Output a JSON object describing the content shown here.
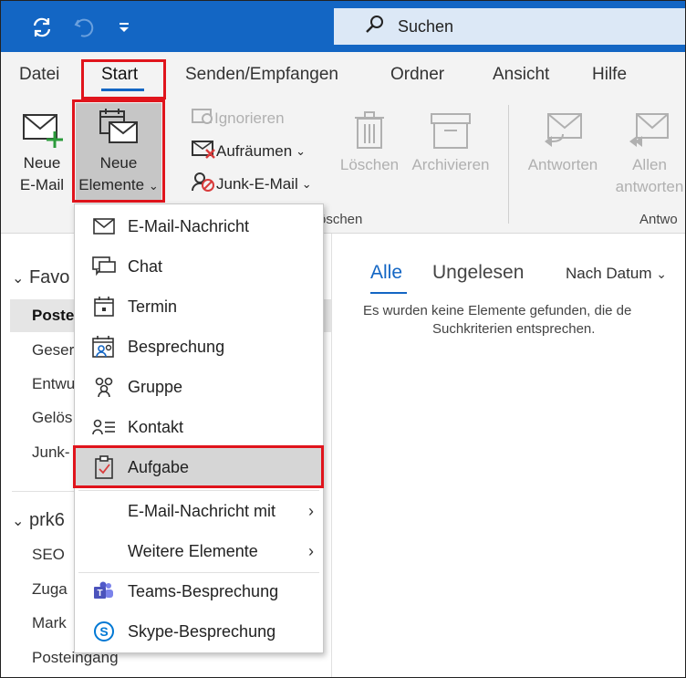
{
  "quick_access": {
    "sync_icon": "sync-icon",
    "undo_icon": "undo-icon",
    "customize_icon": "chevron-down-icon"
  },
  "search": {
    "label": "Suchen"
  },
  "tabs": [
    "Datei",
    "Start",
    "Senden/Empfangen",
    "Ordner",
    "Ansicht",
    "Hilfe"
  ],
  "ribbon": {
    "new_email": {
      "line1": "Neue",
      "line2": "E-Mail"
    },
    "new_items": {
      "line1": "Neue",
      "line2": "Elemente",
      "chevron": "⌄"
    },
    "ignore": "Ignorieren",
    "cleanup": "Aufräumen",
    "junk": "Junk-E-Mail",
    "delete": "Löschen",
    "archive": "Archivieren",
    "delete_group_partial": "öschen",
    "reply": "Antworten",
    "reply_all": {
      "line1": "Allen",
      "line2": "antworten"
    },
    "respond_group_partial": "Antwo"
  },
  "menu": {
    "items": [
      {
        "label": "E-Mail-Nachricht",
        "icon": "mail-icon"
      },
      {
        "label": "Chat",
        "icon": "chat-icon"
      },
      {
        "label": "Termin",
        "icon": "calendar-icon"
      },
      {
        "label": "Besprechung",
        "icon": "meeting-icon"
      },
      {
        "label": "Gruppe",
        "icon": "group-icon"
      },
      {
        "label": "Kontakt",
        "icon": "contact-icon"
      },
      {
        "label": "Aufgabe",
        "icon": "task-icon"
      },
      {
        "label": "E-Mail-Nachricht mit",
        "submenu": true
      },
      {
        "label": "Weitere Elemente",
        "submenu": true
      },
      {
        "label": "Teams-Besprechung",
        "icon": "teams-icon"
      },
      {
        "label": "Skype-Besprechung",
        "icon": "skype-icon"
      }
    ]
  },
  "nav": {
    "favorites_header": "Favo",
    "favorites": [
      "Poste",
      "Geser",
      "Entwu",
      "Gelös",
      "Junk-"
    ],
    "account_header": "prk6",
    "account_items": [
      "SEO",
      "Zuga",
      "Mark",
      "Posteingang"
    ]
  },
  "list": {
    "filter_all": "Alle",
    "filter_unread": "Ungelesen",
    "sort": "Nach Datum",
    "empty_line1": "Es wurden keine Elemente gefunden, die de",
    "empty_line2": "Suchkriterien entsprechen."
  },
  "colors": {
    "titlebar": "#1366c4",
    "accent": "#1366c4",
    "highlight_box": "#e0141c",
    "teams": "#5059c9",
    "skype": "#0078d4"
  }
}
